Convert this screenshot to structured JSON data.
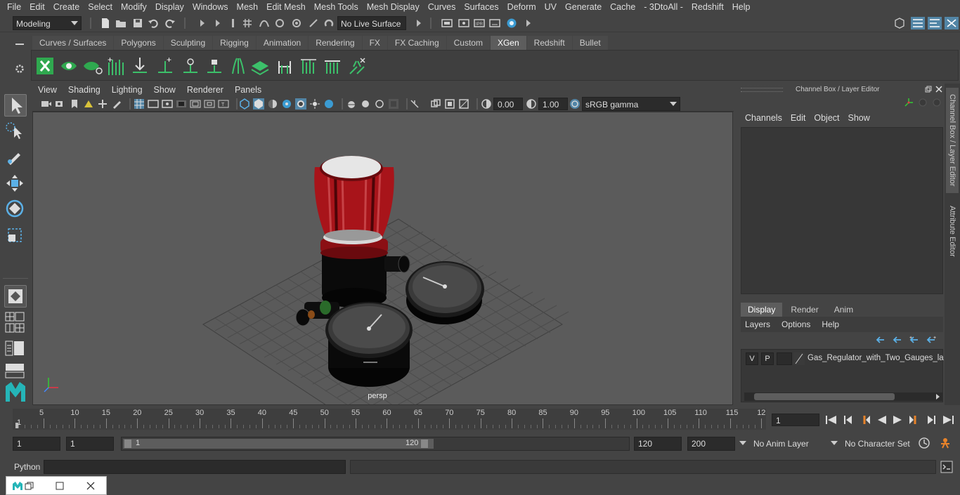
{
  "menubar": [
    "File",
    "Edit",
    "Create",
    "Select",
    "Modify",
    "Display",
    "Windows",
    "Mesh",
    "Edit Mesh",
    "Mesh Tools",
    "Mesh Display",
    "Curves",
    "Surfaces",
    "Deform",
    "UV",
    "Generate",
    "Cache",
    "- 3DtoAll -",
    "Redshift",
    "Help"
  ],
  "status": {
    "menu_set": "Modeling",
    "live_surface": "No Live Surface"
  },
  "shelf": {
    "tabs": [
      "Curves / Surfaces",
      "Polygons",
      "Sculpting",
      "Rigging",
      "Animation",
      "Rendering",
      "FX",
      "FX Caching",
      "Custom",
      "XGen",
      "Redshift",
      "Bullet"
    ],
    "active": "XGen"
  },
  "viewport": {
    "menus": [
      "View",
      "Shading",
      "Lighting",
      "Show",
      "Renderer",
      "Panels"
    ],
    "exposure": "0.00",
    "gamma": "1.00",
    "color_space": "sRGB gamma",
    "camera_label": "persp"
  },
  "channel_box": {
    "title": "Channel Box / Layer Editor",
    "menus": [
      "Channels",
      "Edit",
      "Object",
      "Show"
    ],
    "layer_tabs": [
      "Display",
      "Render",
      "Anim"
    ],
    "active_layer_tab": "Display",
    "layer_menus": [
      "Layers",
      "Options",
      "Help"
    ],
    "layer": {
      "v": "V",
      "p": "P",
      "name": "Gas_Regulator_with_Two_Gauges_la"
    }
  },
  "side_tabs": [
    "Channel Box / Layer Editor",
    "Attribute Editor"
  ],
  "timeline": {
    "ticks": [
      "5",
      "10",
      "15",
      "20",
      "25",
      "30",
      "35",
      "40",
      "45",
      "50",
      "55",
      "60",
      "65",
      "70",
      "75",
      "80",
      "85",
      "90",
      "95",
      "100",
      "105",
      "110",
      "115",
      "12"
    ],
    "start_label": "1",
    "current_frame": "1"
  },
  "range": {
    "start": "1",
    "anim_start": "1",
    "slider_start": "1",
    "slider_end": "120",
    "anim_end": "120",
    "end": "200",
    "anim_layer": "No Anim Layer",
    "character_set": "No Character Set"
  },
  "cmdline": {
    "label": "Python"
  },
  "colors": {
    "accent": "#5285a6",
    "xgen_green": "#2fa84f",
    "regulator_red": "#a8141a"
  }
}
